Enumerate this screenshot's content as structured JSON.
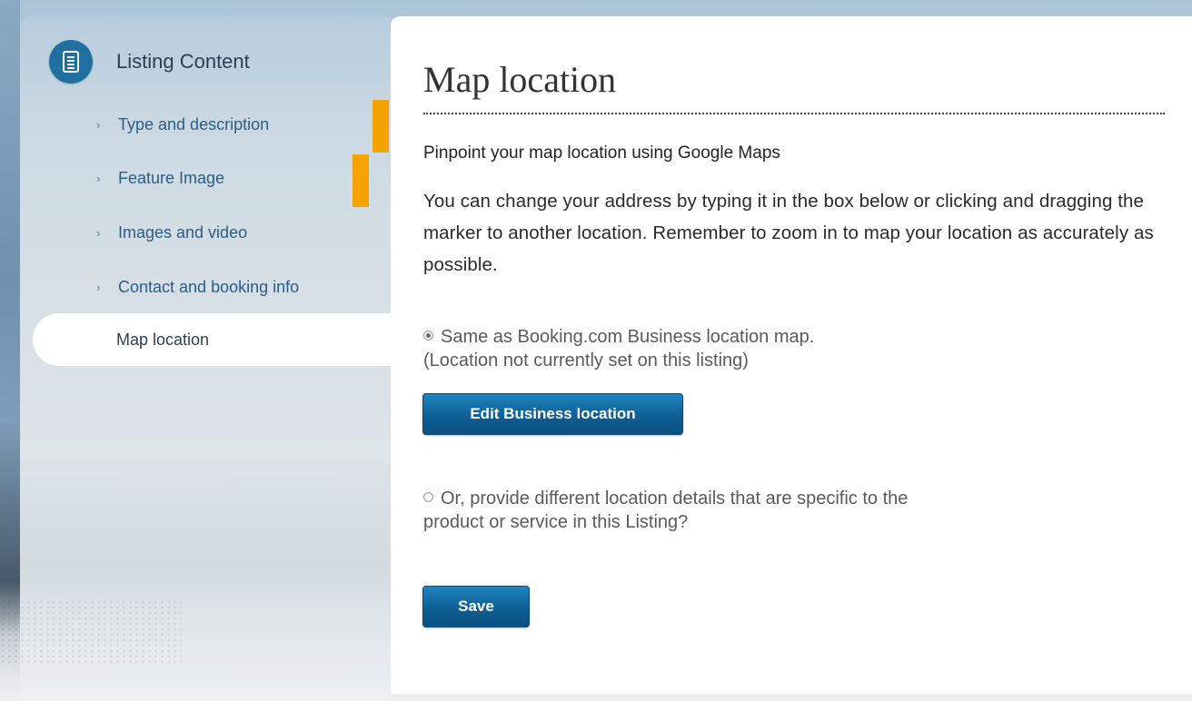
{
  "sidebar": {
    "header": {
      "title": "Listing Content",
      "icon": "document-list-icon"
    },
    "items": [
      {
        "label": "Type and description",
        "chevron": "›"
      },
      {
        "label": "Feature Image",
        "chevron": "›"
      },
      {
        "label": "Images and video",
        "chevron": "›"
      },
      {
        "label": "Contact and booking info",
        "chevron": "›"
      },
      {
        "label": "Map location",
        "active": true
      }
    ]
  },
  "main": {
    "title": "Map location",
    "subheading": "Pinpoint your map location using Google Maps",
    "description": "You can change your address by typing it in the box below or clicking and dragging the marker to another location. Remember to zoom in to map your location as accurately as possible.",
    "option_same": {
      "line1": "Same as Booking.com Business location map.",
      "line2": "(Location not currently set on this listing)",
      "selected": true
    },
    "edit_button_label": "Edit Business location",
    "option_different": {
      "line1": "Or, provide different location details that are specific to the",
      "line2": "product or service in this Listing?",
      "selected": false
    },
    "save_button_label": "Save"
  },
  "colors": {
    "accent_blue": "#0e5f95",
    "orange_marker": "#f5a300",
    "nav_link": "#2d5c85"
  }
}
